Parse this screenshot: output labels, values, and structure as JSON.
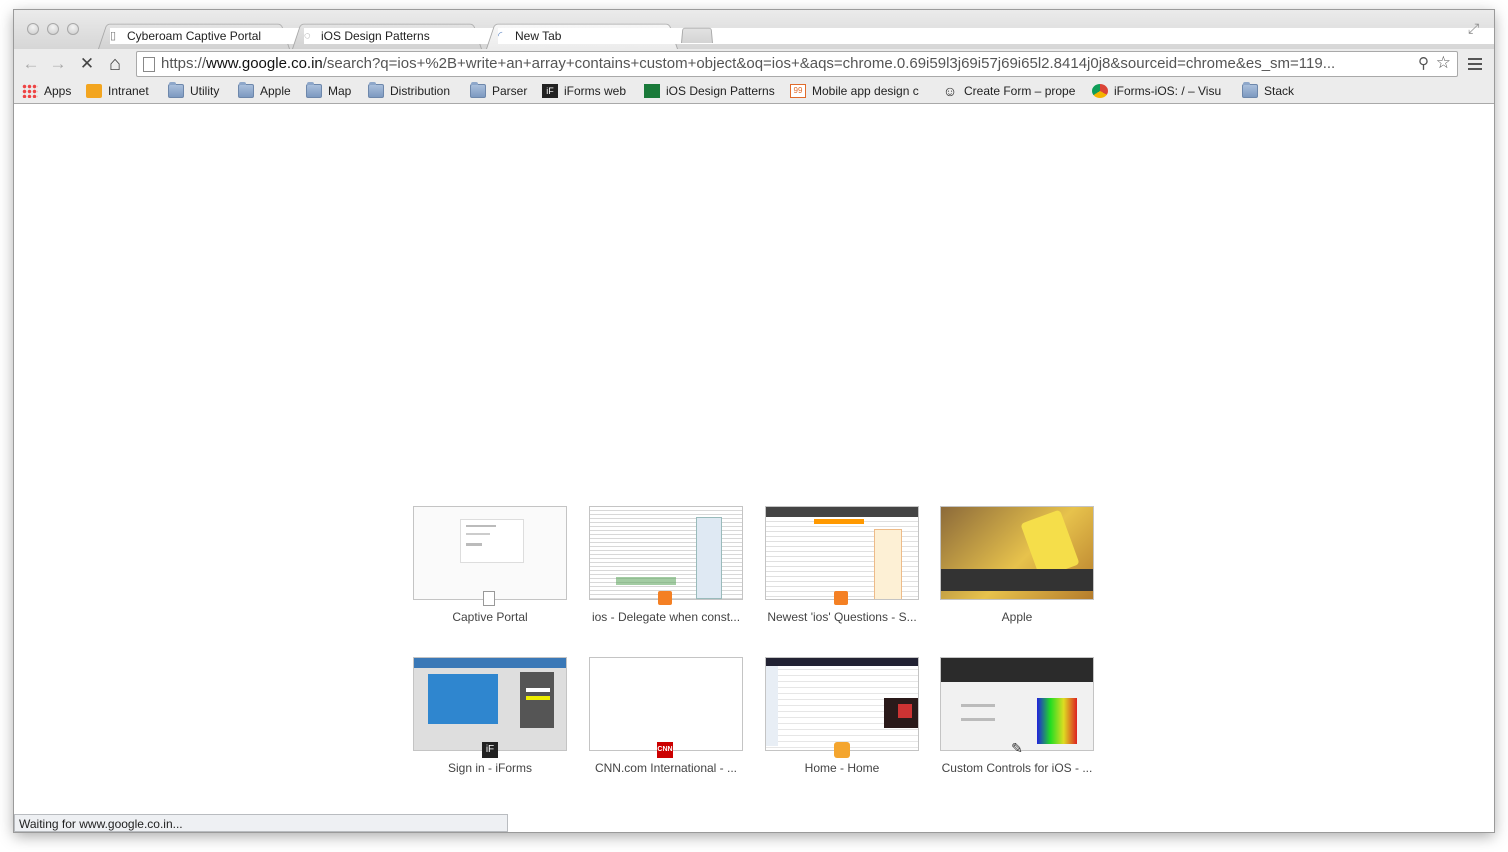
{
  "tabs": [
    {
      "title": "Cyberoam Captive Portal",
      "close": "×",
      "icon": "page-icon"
    },
    {
      "title": "iOS Design Patterns",
      "close": "×",
      "icon": "loading-spinner-icon"
    },
    {
      "title": "New Tab",
      "close": "×",
      "icon": "loading-spinner-icon",
      "active": true
    }
  ],
  "toolbar": {
    "back": "←",
    "forward": "→",
    "stop": "✕",
    "home": "⌂",
    "url_scheme": "https://",
    "url_host": "www.google.co.in",
    "url_path": "/search?q=ios+%2B+write+an+array+contains+custom+object&oq=ios+&aqs=chrome.0.69i59l3j69i57j69i65l2.8414j0j8&sourceid=chrome&es_sm=119...",
    "zoom": "⚲",
    "star": "☆"
  },
  "bookmarks": [
    {
      "label": "Apps",
      "icon": "apps-grid-icon"
    },
    {
      "label": "Intranet",
      "icon": "intranet-icon"
    },
    {
      "label": "Utility",
      "icon": "folder-icon"
    },
    {
      "label": "Apple",
      "icon": "folder-icon"
    },
    {
      "label": "Map",
      "icon": "folder-icon"
    },
    {
      "label": "Distribution",
      "icon": "folder-icon"
    },
    {
      "label": "Parser",
      "icon": "folder-icon"
    },
    {
      "label": "iForms web",
      "icon": "iforms-icon"
    },
    {
      "label": "iOS Design Patterns",
      "icon": "ios-design-icon"
    },
    {
      "label": "Mobile app design c",
      "icon": "99designs-icon"
    },
    {
      "label": "Create Form – prope",
      "icon": "smiley-icon"
    },
    {
      "label": "iForms-iOS: / – Visu",
      "icon": "chrome-icon"
    },
    {
      "label": "Stack",
      "icon": "folder-icon"
    }
  ],
  "most_visited": [
    {
      "label": "Captive Portal"
    },
    {
      "label": "ios - Delegate when const..."
    },
    {
      "label": "Newest 'ios' Questions - S..."
    },
    {
      "label": "Apple"
    },
    {
      "label": "Sign in - iForms"
    },
    {
      "label": "CNN.com International - ..."
    },
    {
      "label": "Home - Home"
    },
    {
      "label": "Custom Controls for iOS - ..."
    }
  ],
  "status": "Waiting for www.google.co.in..."
}
